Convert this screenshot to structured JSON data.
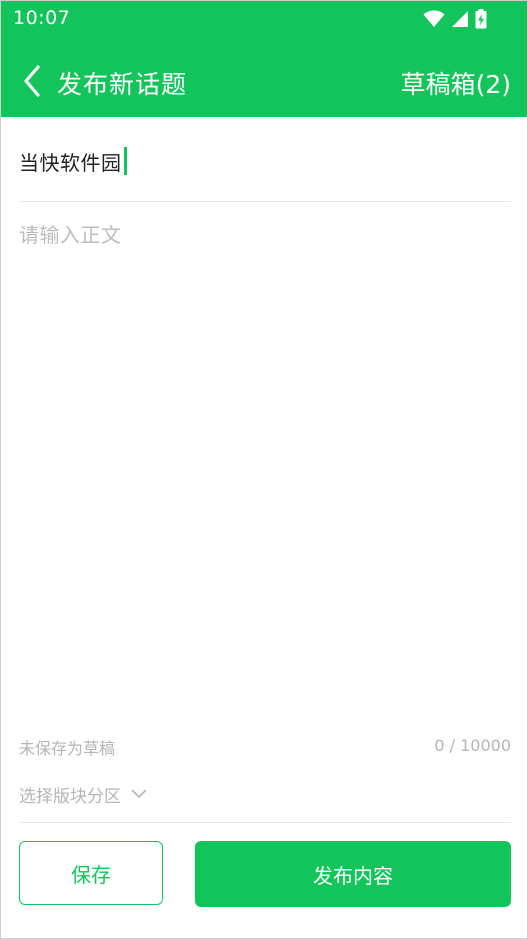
{
  "status_bar": {
    "time": "10:07",
    "icons": [
      "wifi-icon",
      "cellular-signal-icon",
      "battery-charging-icon"
    ]
  },
  "header": {
    "title": "发布新话题",
    "drafts_label": "草稿箱(2)",
    "back_icon": "chevron-left-icon"
  },
  "editor": {
    "title_value": "当快软件园",
    "body_value": "",
    "body_placeholder": "请输入正文"
  },
  "footer_info": {
    "draft_status": "未保存为草稿",
    "char_count": "0 / 10000"
  },
  "section_select": {
    "label": "选择版块分区",
    "icon": "chevron-down-icon"
  },
  "actions": {
    "save_label": "保存",
    "publish_label": "发布内容"
  },
  "colors": {
    "brand": "#13c45a",
    "placeholder": "#bdbdbd",
    "muted_text": "#b5b5b5",
    "divider": "#e8e8e8"
  }
}
